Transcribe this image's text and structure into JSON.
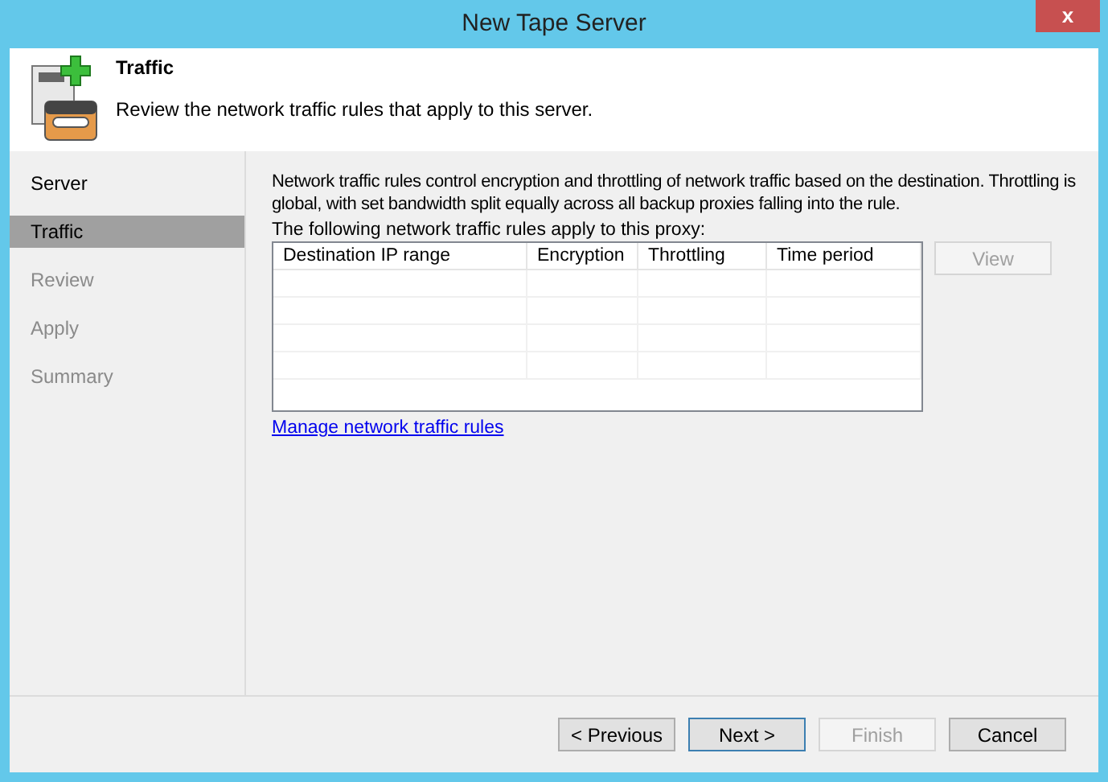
{
  "window": {
    "title": "New Tape Server",
    "close": "x"
  },
  "header": {
    "title": "Traffic",
    "subtitle": "Review the network traffic rules that apply to this server."
  },
  "sidebar": {
    "items": [
      {
        "label": "Server",
        "selected": false,
        "disabled": false
      },
      {
        "label": "Traffic",
        "selected": true,
        "disabled": false
      },
      {
        "label": "Review",
        "selected": false,
        "disabled": true
      },
      {
        "label": "Apply",
        "selected": false,
        "disabled": true
      },
      {
        "label": "Summary",
        "selected": false,
        "disabled": true
      }
    ]
  },
  "content": {
    "description": "Network traffic rules control encryption and throttling of network traffic based on the destination. Throttling is global, with set bandwidth split equally across all backup proxies falling into the rule.",
    "table_label": "The following network traffic rules apply to this proxy:",
    "table": {
      "columns": [
        "Destination IP range",
        "Encryption",
        "Throttling",
        "Time period"
      ]
    },
    "view_button": {
      "label": "View",
      "disabled": true
    },
    "link": "Manage network traffic rules"
  },
  "buttons": [
    {
      "label": "< Previous",
      "disabled": false,
      "focused": false
    },
    {
      "label": "Next >",
      "disabled": false,
      "focused": true
    },
    {
      "label": "Finish",
      "disabled": true,
      "focused": false
    },
    {
      "label": "Cancel",
      "disabled": false,
      "focused": false
    }
  ]
}
